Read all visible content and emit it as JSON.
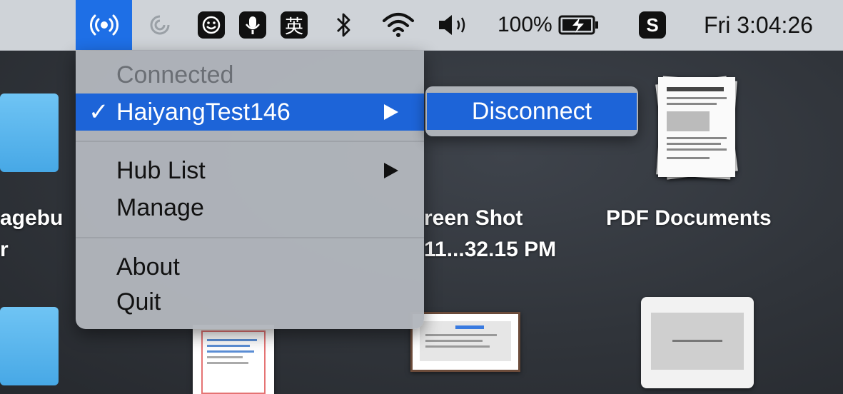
{
  "menubar": {
    "icons": [
      "broadcast-icon",
      "spiral-icon",
      "smiley-icon",
      "microphone-icon",
      "input-method-icon",
      "bluetooth-icon",
      "wifi-icon",
      "volume-icon",
      "battery-icon",
      "s-app-icon"
    ],
    "input_method_char": "英",
    "s_app_char": "S",
    "battery_percent": "100%",
    "clock": "Fri 3:04:26",
    "accent_color": "#1e6fe6"
  },
  "menu": {
    "header": "Connected",
    "selected_check": "✓",
    "selected_item": "HaiyangTest146",
    "items": [
      "Hub List",
      "Manage",
      "About",
      "Quit"
    ],
    "submenu_item": "Disconnect",
    "highlight_color": "#1d64d8"
  },
  "desktop": {
    "items": [
      {
        "line1": "agebu",
        "line2": "r"
      },
      {
        "line1": "reen Shot",
        "line2": "11...32.15 PM"
      },
      {
        "line1": "PDF Documents",
        "line2": ""
      }
    ]
  }
}
